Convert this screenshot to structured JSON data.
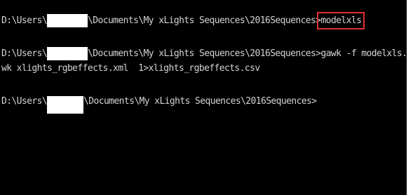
{
  "console": {
    "line1": {
      "prefix": "D:\\Users\\",
      "suffix": "\\Documents\\My xLights Sequences\\2016Sequences>",
      "command": "modelxls"
    },
    "line2": {
      "prefix": "D:\\Users\\",
      "suffix": "\\Documents\\My xLights Sequences\\2016Sequences>gawk -f modelxls.a"
    },
    "line3": {
      "text": "wk xlights_rgbeffects.xml  1>xlights_rgbeffects.csv"
    },
    "line4": {
      "prefix": "D:\\Users\\",
      "suffix": "\\Documents\\My xLights Sequences\\2016Sequences>"
    }
  },
  "colors": {
    "background": "#000000",
    "text": "#d4d4d4",
    "highlight_box": "#e03131",
    "redaction": "#ffffff"
  }
}
